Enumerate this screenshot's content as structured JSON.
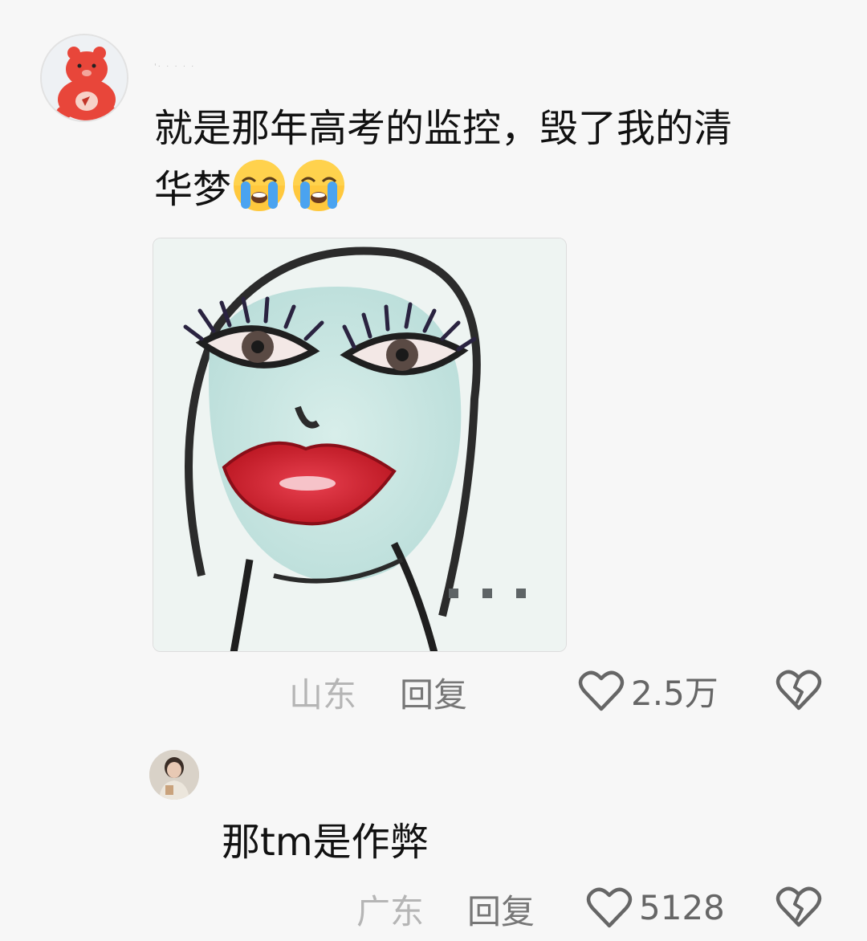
{
  "main_comment": {
    "username": "'· · · · ·",
    "text_line1": "就是那年高考的监控，毁了我的清",
    "text_line2": "华梦",
    "emojis": [
      "loudly-crying-face-icon",
      "loudly-crying-face-icon"
    ],
    "location": "山东",
    "reply_label": "回复",
    "like_count": "2.5万"
  },
  "reply_comment": {
    "text": "那tm是作弊",
    "location": "广东",
    "reply_label": "回复",
    "like_count": "5128"
  }
}
